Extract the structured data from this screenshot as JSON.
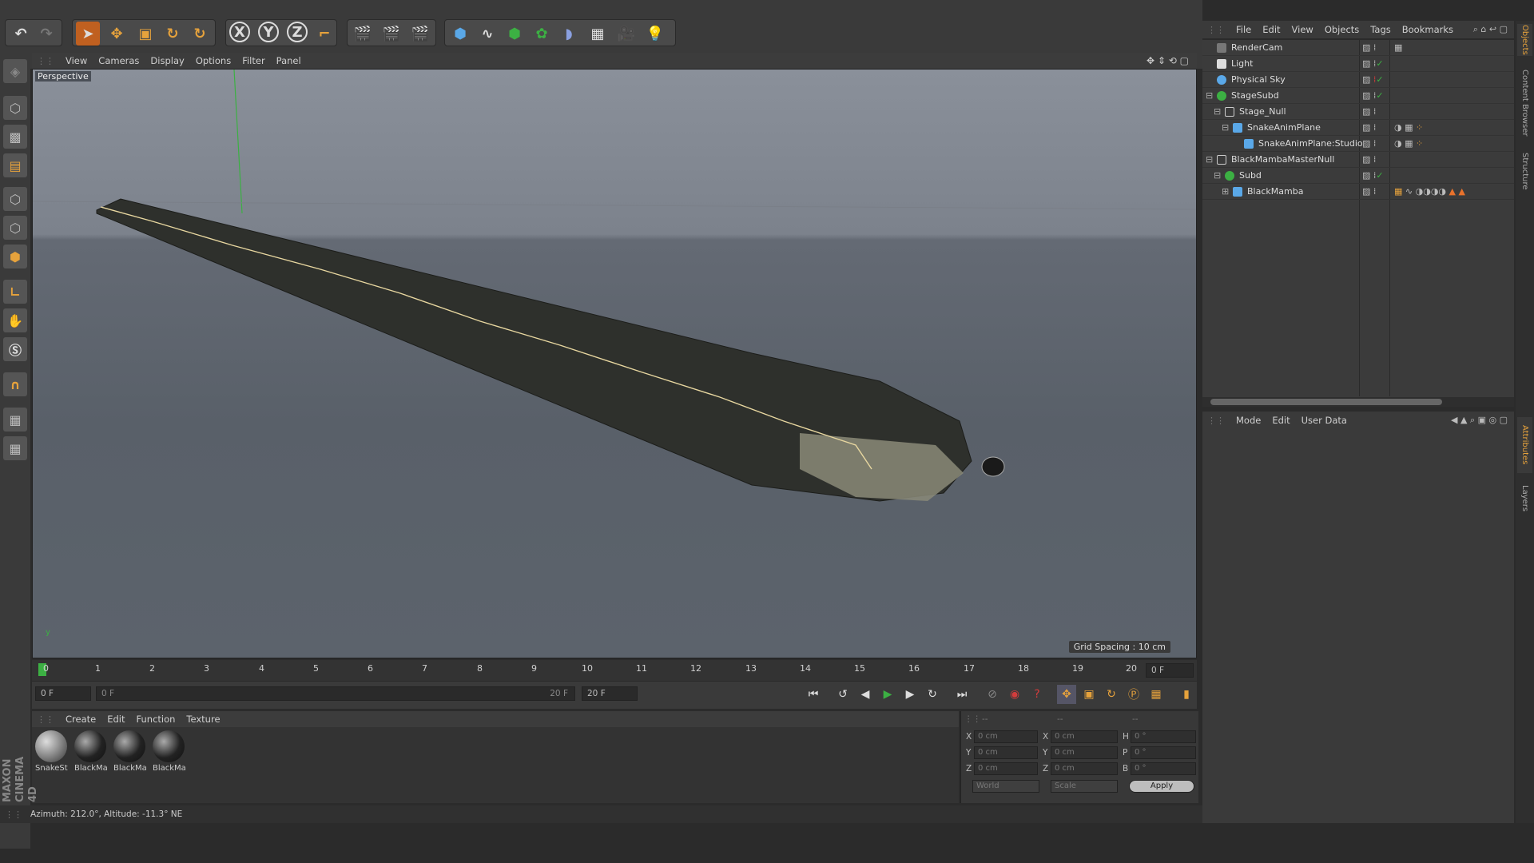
{
  "toolbar": {
    "buttons": [
      "undo-icon",
      "redo-icon",
      "live-selection-icon",
      "move-icon",
      "scale-icon",
      "rotate-icon",
      "recent-tool-icon",
      "x-axis-icon",
      "y-axis-icon",
      "z-axis-icon",
      "coordinate-system-icon",
      "render-view-icon",
      "render-picture-viewer-icon",
      "render-settings-icon",
      "cube-icon",
      "spline-pen-icon",
      "subdivision-icon",
      "array-icon",
      "deformer-icon",
      "floor-icon",
      "camera-icon",
      "light-icon"
    ],
    "axis_labels": [
      "X",
      "Y",
      "Z"
    ]
  },
  "viewport": {
    "menu": [
      "View",
      "Cameras",
      "Display",
      "Options",
      "Filter",
      "Panel"
    ],
    "label": "Perspective",
    "grid_spacing": "Grid Spacing : 10 cm"
  },
  "timeline": {
    "ticks": [
      "0",
      "1",
      "2",
      "3",
      "4",
      "5",
      "6",
      "7",
      "8",
      "9",
      "10",
      "11",
      "12",
      "13",
      "14",
      "15",
      "16",
      "17",
      "18",
      "19",
      "20"
    ],
    "current_frame": "0 F",
    "start_frame": "0 F",
    "range_start": "0 F",
    "range_end": "20 F",
    "end_frame": "20 F"
  },
  "materials": {
    "menu": [
      "Create",
      "Edit",
      "Function",
      "Texture"
    ],
    "items": [
      {
        "label": "SnakeSt"
      },
      {
        "label": "BlackMa"
      },
      {
        "label": "BlackMa"
      },
      {
        "label": "BlackMa"
      }
    ]
  },
  "coordinates": {
    "headers": [
      "--",
      "--",
      "--"
    ],
    "rows": [
      {
        "a": "X",
        "av": "0 cm",
        "b": "X",
        "bv": "0 cm",
        "c": "H",
        "cv": "0 °"
      },
      {
        "a": "Y",
        "av": "0 cm",
        "b": "Y",
        "bv": "0 cm",
        "c": "P",
        "cv": "0 °"
      },
      {
        "a": "Z",
        "av": "0 cm",
        "b": "Z",
        "bv": "0 cm",
        "c": "B",
        "cv": "0 °"
      }
    ],
    "mode_select": "World",
    "scale_select": "Scale",
    "apply_label": "Apply"
  },
  "status": {
    "text": "Azimuth: 212.0°, Altitude: -11.3°  NE"
  },
  "branding": {
    "line1": "MAXON",
    "line2": "CINEMA 4D"
  },
  "object_manager": {
    "menu": [
      "File",
      "Edit",
      "View",
      "Objects",
      "Tags",
      "Bookmarks"
    ],
    "items": [
      {
        "name": "RenderCam",
        "indent": 0
      },
      {
        "name": "Light",
        "indent": 0
      },
      {
        "name": "Physical Sky",
        "indent": 0
      },
      {
        "name": "StageSubd",
        "indent": 0
      },
      {
        "name": "Stage_Null",
        "indent": 1
      },
      {
        "name": "SnakeAnimPlane",
        "indent": 2
      },
      {
        "name": "SnakeAnimPlane:Studio",
        "indent": 3
      },
      {
        "name": "BlackMambaMasterNull",
        "indent": 0
      },
      {
        "name": "Subd",
        "indent": 1
      },
      {
        "name": "BlackMamba",
        "indent": 2
      }
    ]
  },
  "attribute_manager": {
    "menu": [
      "Mode",
      "Edit",
      "User Data"
    ]
  },
  "side_tabs": [
    "Objects",
    "Content Browser",
    "Structure",
    "Attributes",
    "Layers"
  ],
  "colors": {
    "accent": "#e6a23c",
    "select_blue": "#4a90d9",
    "green": "#3cb043",
    "red": "#d23c3c"
  }
}
